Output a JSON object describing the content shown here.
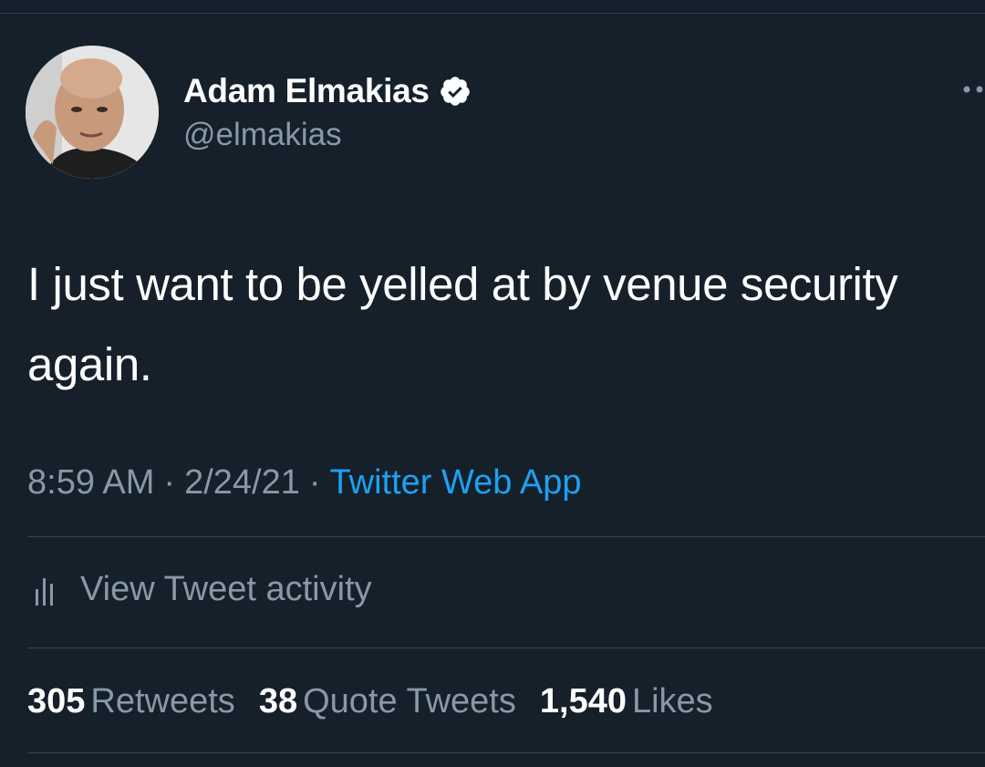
{
  "author": {
    "display_name": "Adam Elmakias",
    "handle": "@elmakias",
    "verified": true
  },
  "tweet": {
    "text": "I just want to be yelled at by venue security again.",
    "time": "8:59 AM",
    "date": "2/24/21",
    "separator": "·",
    "source": "Twitter Web App"
  },
  "activity": {
    "label": "View Tweet activity"
  },
  "stats": [
    {
      "count": "305",
      "label": "Retweets"
    },
    {
      "count": "38",
      "label": "Quote Tweets"
    },
    {
      "count": "1,540",
      "label": "Likes"
    }
  ],
  "icons": {
    "verified": "verified-badge-icon",
    "more": "more-options-icon",
    "analytics": "analytics-bars-icon"
  },
  "colors": {
    "background": "#15202b",
    "primary_text": "#ffffff",
    "secondary_text": "#8899a6",
    "link": "#1da1f2",
    "divider": "#38444d"
  }
}
